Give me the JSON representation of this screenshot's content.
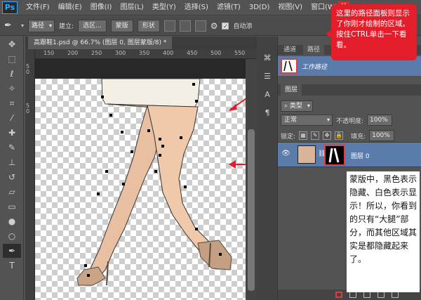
{
  "menubar": {
    "logo": "Ps",
    "items": [
      "文件(F)",
      "编辑(E)",
      "图像(I)",
      "图层(L)",
      "类型(Y)",
      "选择(S)",
      "滤镜(T)",
      "3D(D)",
      "视图(V)",
      "窗口(W)"
    ]
  },
  "options": {
    "mode": "路径",
    "build_label": "建立:",
    "selection_btn": "选区...",
    "mask_btn": "蒙版",
    "shape_btn": "形状",
    "auto_add": "自动添"
  },
  "document": {
    "tab_title": "高跟鞋1.psd @ 66.7% (图层 0, 图层蒙版/8) *",
    "ruler_numbers": [
      "150",
      "200",
      "250",
      "300",
      "350",
      "400",
      "450",
      "500",
      "550"
    ],
    "vruler_numbers": [
      "5",
      "0",
      "5",
      "0"
    ]
  },
  "paths": {
    "tabs": [
      "通道",
      "路径"
    ],
    "path_name": "工作路径"
  },
  "layers": {
    "tab": "图层",
    "filter": "类型",
    "blend_mode": "正常",
    "opacity_label": "不透明度:",
    "opacity": "100%",
    "lock_label": "锁定:",
    "fill_label": "填充:",
    "fill": "100%",
    "layer_name": "图层 0"
  },
  "annotations": {
    "top": "这里的路径面板则显示了你刚才绘制的区域。按住CTRL单击一下看看。",
    "side": "蒙版中，黑色表示隐藏、白色表示显示！所以，你看到的只有“大腿”部分，而其他区域其实是都隐藏起来了。"
  },
  "colors": {
    "accent_red": "#e41d2a",
    "selection_blue": "#5b7bab",
    "panel_bg": "#535353"
  }
}
